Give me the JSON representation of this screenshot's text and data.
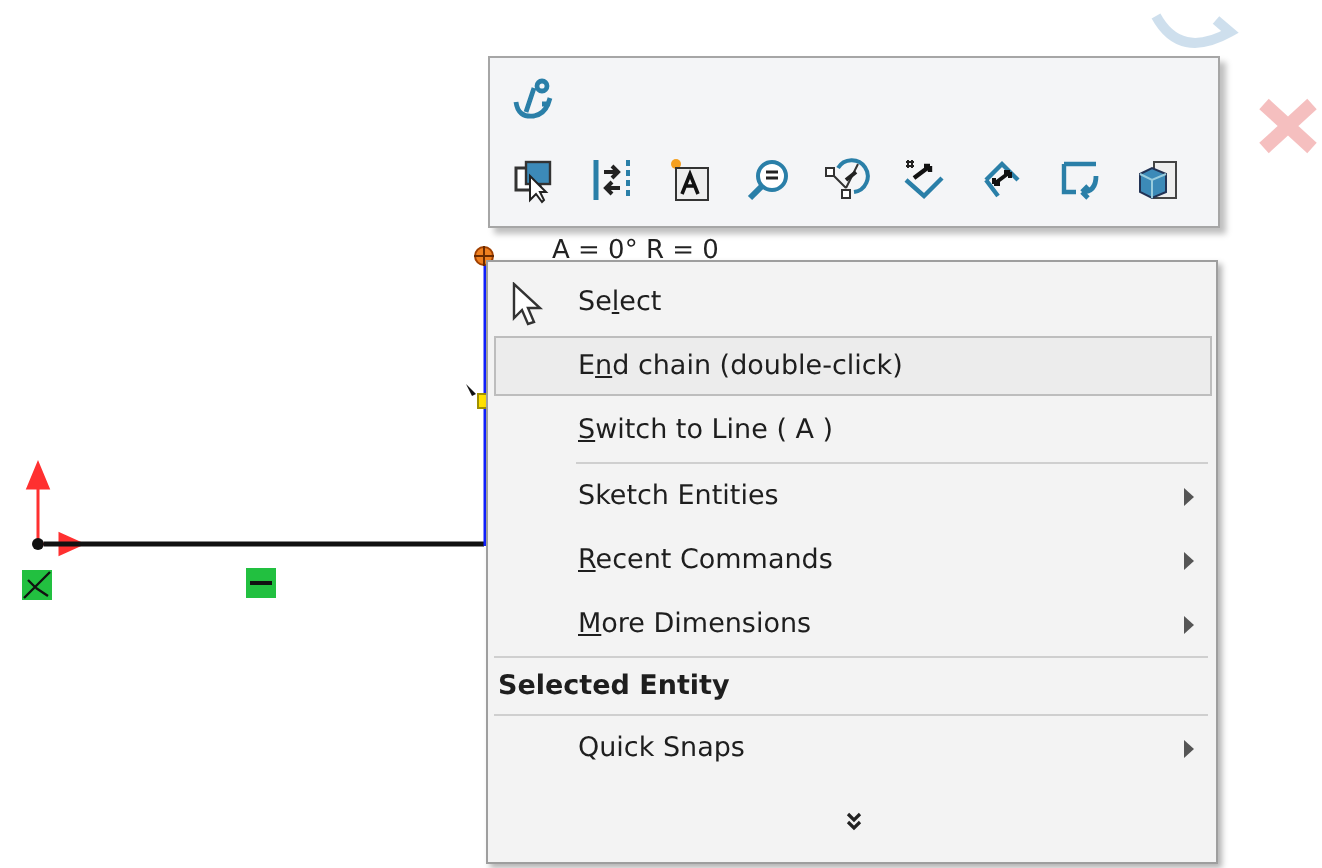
{
  "canvas": {
    "dimension_readout": "A = 0° R = 0"
  },
  "context_menu": {
    "items": [
      {
        "kind": "tool",
        "pre": "Se",
        "key": "l",
        "post": "ect",
        "selected": false,
        "separator_before": false
      },
      {
        "kind": "command",
        "pre": "E",
        "key": "n",
        "post": "d chain  (double-click)",
        "selected": true,
        "separator_before": false
      },
      {
        "kind": "command",
        "key": "S",
        "post": "witch to Line  ( A )",
        "selected": false,
        "separator_before": false
      },
      {
        "kind": "submenu",
        "pre": "Sketch Entities",
        "selected": false,
        "separator_before": true
      },
      {
        "kind": "submenu",
        "key": "R",
        "post": "ecent Commands",
        "selected": false,
        "separator_before": false
      },
      {
        "kind": "submenu",
        "key": "M",
        "post": "ore Dimensions",
        "selected": false,
        "separator_before": false
      },
      {
        "kind": "header",
        "pre": "Selected Entity",
        "separator_before": true
      },
      {
        "kind": "submenu",
        "pre": "Quick Snaps",
        "selected": false,
        "separator_before": true
      }
    ]
  }
}
